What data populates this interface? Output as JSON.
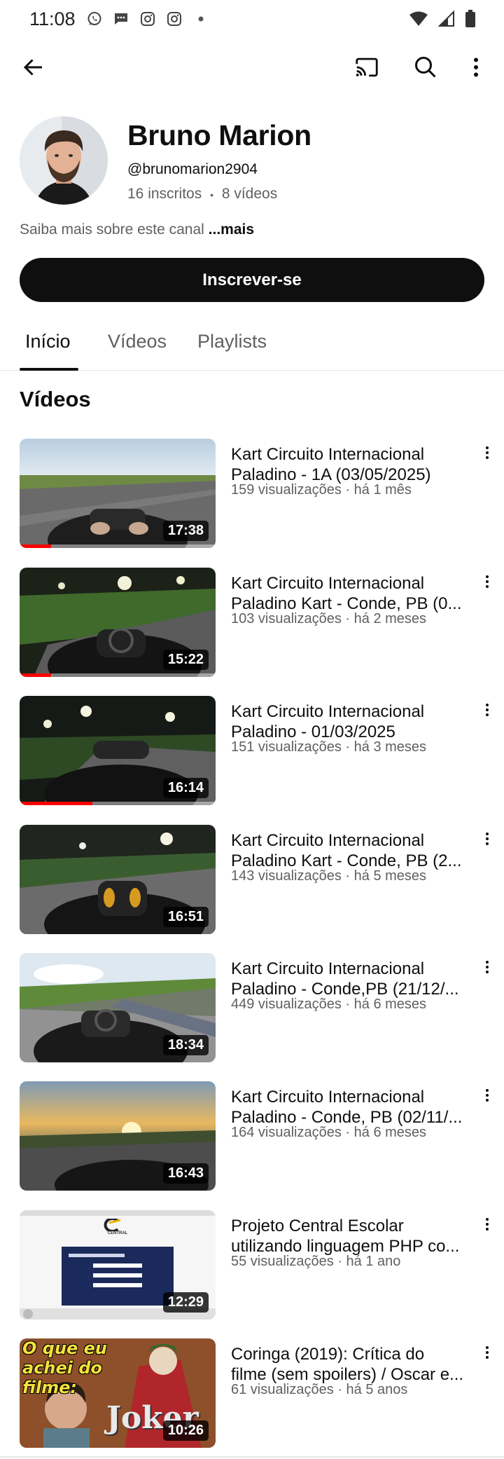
{
  "status_bar": {
    "time": "11:08"
  },
  "channel": {
    "name": "Bruno Marion",
    "handle": "@brunomarion2904",
    "subscribers": "16 inscritos",
    "separator": "•",
    "video_count": "8 vídeos",
    "about": "Saiba mais sobre este canal",
    "about_more": "...mais",
    "subscribe_label": "Inscrever-se"
  },
  "tabs": [
    {
      "label": "Início",
      "active": true
    },
    {
      "label": "Vídeos",
      "active": false
    },
    {
      "label": "Playlists",
      "active": false
    }
  ],
  "section_title": "Vídeos",
  "videos": [
    {
      "title1": "Kart Circuito Internacional",
      "title2": "Paladino - 1A (03/05/2025)",
      "meta": "159 visualizações · há 1 mês",
      "duration": "17:38",
      "watched": 0.16
    },
    {
      "title1": "Kart Circuito Internacional",
      "title2": "Paladino Kart - Conde, PB (0...",
      "meta": "103 visualizações · há 2 meses",
      "duration": "15:22",
      "watched": 0.16
    },
    {
      "title1": "Kart Circuito Internacional",
      "title2": "Paladino - 01/03/2025",
      "meta": "151 visualizações · há 3 meses",
      "duration": "16:14",
      "watched": 0.37
    },
    {
      "title1": "Kart Circuito Internacional",
      "title2": "Paladino Kart - Conde, PB (2...",
      "meta": "143 visualizações · há 5 meses",
      "duration": "16:51",
      "watched": 0
    },
    {
      "title1": "Kart Circuito Internacional",
      "title2": "Paladino - Conde,PB (21/12/...",
      "meta": "449 visualizações · há 6 meses",
      "duration": "18:34",
      "watched": 0
    },
    {
      "title1": "Kart Circuito Internacional",
      "title2": "Paladino - Conde, PB (02/11/...",
      "meta": "164 visualizações · há 6 meses",
      "duration": "16:43",
      "watched": 0
    },
    {
      "title1": "Projeto Central Escolar",
      "title2": "utilizando linguagem PHP co...",
      "meta": "55 visualizações · há 1 ano",
      "duration": "12:29",
      "watched": 0
    },
    {
      "title1": "Coringa (2019): Crítica do",
      "title2": "filme (sem spoilers) / Oscar e...",
      "meta": "61 visualizações · há 5 anos",
      "duration": "10:26",
      "watched": 0
    }
  ],
  "thumb_overlay": {
    "coringa_text": "O que eu achei do filme:",
    "joker_logo": "Joker",
    "site_name": "CENTRAL"
  },
  "colors": {
    "accent": "#ff0000",
    "text_primary": "#0f0f0f",
    "text_secondary": "#606060"
  },
  "icons": [
    "back-arrow-icon",
    "cast-icon",
    "search-icon",
    "more-vert-icon"
  ]
}
